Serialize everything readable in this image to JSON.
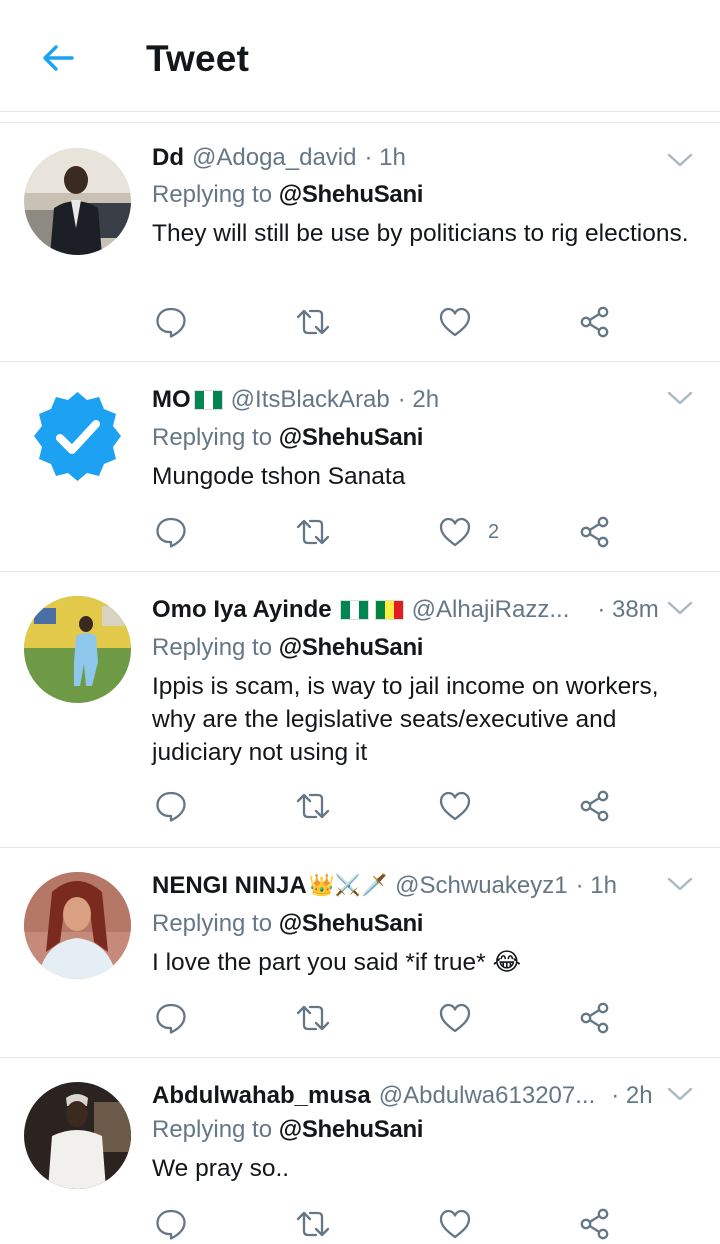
{
  "header": {
    "title": "Tweet"
  },
  "tweets": [
    {
      "name": "Dd",
      "handle": "@Adoga_david",
      "time": "· 1h",
      "replying_prefix": "Replying to",
      "replying_to": "@ShehuSani",
      "text": "They will still be use by politicians to rig elections.",
      "like_count": ""
    },
    {
      "name": "MO",
      "handle": "@ItsBlackArab",
      "time": "· 2h",
      "replying_prefix": "Replying to",
      "replying_to": "@ShehuSani",
      "text": "Mungode tshon Sanata",
      "like_count": "2"
    },
    {
      "name": "Omo Iya Ayinde",
      "handle": "@AlhajiRazz...",
      "time": "· 38m",
      "replying_prefix": "Replying to",
      "replying_to": "@ShehuSani",
      "text": "Ippis is scam, is way to jail income on workers, why are the legislative seats/executive and judiciary not using it",
      "like_count": ""
    },
    {
      "name": "NENGI NINJA",
      "name_emoji": "👑⚔️🗡️",
      "handle": "@Schwuakeyz1",
      "time": "· 1h",
      "replying_prefix": "Replying to",
      "replying_to": "@ShehuSani",
      "text": "I love the part you said *if true* 😂",
      "like_count": ""
    },
    {
      "name": "Abdulwahab_musa",
      "handle": "@Abdulwa613207...",
      "time": "· 2h",
      "replying_prefix": "Replying to",
      "replying_to": "@ShehuSani",
      "text": "We pray so..",
      "like_count": ""
    }
  ],
  "colors": {
    "accent": "#1da1f2",
    "icon_gray": "#657786",
    "verified_blue": "#1da1f2",
    "nigeria_green": "#008751",
    "senegal_yellow": "#fdef42",
    "senegal_red": "#e31b23"
  },
  "icons": [
    "back-arrow-icon",
    "chevron-down-icon",
    "reply-icon",
    "retweet-icon",
    "like-icon",
    "share-icon",
    "verified-badge-icon"
  ]
}
